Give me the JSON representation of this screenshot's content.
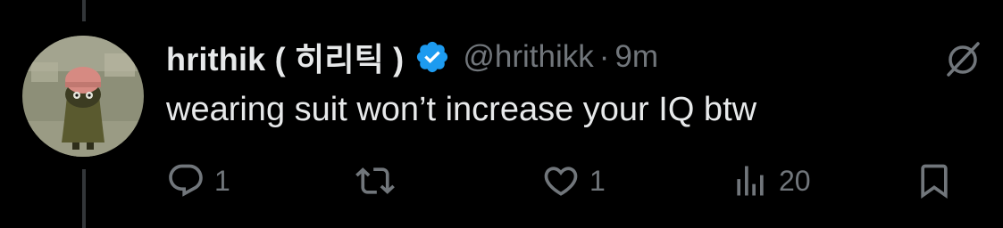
{
  "tweet": {
    "display_name": "hrithik ( 히리틱 )",
    "handle": "@hrithikk",
    "separator": "·",
    "time": "9m",
    "text": "wearing suit won’t increase your IQ btw"
  },
  "actions": {
    "reply_count": "1",
    "like_count": "1",
    "views_count": "20"
  },
  "colors": {
    "background": "#000000",
    "primary_text": "#e7e9ea",
    "secondary_text": "#71767b",
    "verified_blue": "#1d9bf0",
    "thread_line": "#333639"
  },
  "icons": {
    "verified": "verified-badge-icon",
    "grok": "grok-icon",
    "reply": "reply-icon",
    "retweet": "retweet-icon",
    "like": "heart-icon",
    "views": "views-chart-icon",
    "bookmark": "bookmark-icon"
  }
}
